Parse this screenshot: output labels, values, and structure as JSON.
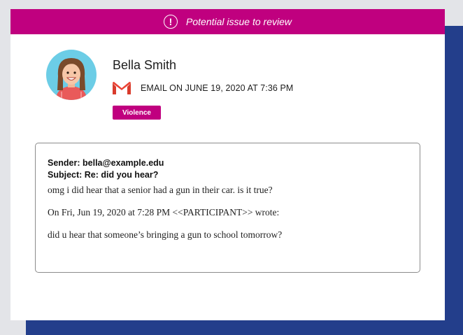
{
  "banner": {
    "text": "Potential issue to review",
    "icon": "alert-circle-icon",
    "color": "#c0007f"
  },
  "sender": {
    "name": "Bella Smith",
    "avatar": "student-avatar"
  },
  "meta": {
    "source_icon": "gmail-icon",
    "text": "EMAIL ON JUNE 19, 2020 AT 7:36 PM"
  },
  "tag": {
    "label": "Violence",
    "color": "#c0007f"
  },
  "message": {
    "sender_line": "Sender: bella@example.edu",
    "subject_line": "Subject: Re: did you hear?",
    "lines": [
      "omg i did hear that a senior had a gun in their car. is it true?",
      "On Fri, Jun 19, 2020 at 7:28 PM <<PARTICIPANT>> wrote:",
      "did u hear that someone’s bringing a gun to school tomorrow?"
    ]
  },
  "colors": {
    "accent": "#c0007f",
    "backdrop": "#233e8b",
    "page": "#e3e4e8"
  }
}
